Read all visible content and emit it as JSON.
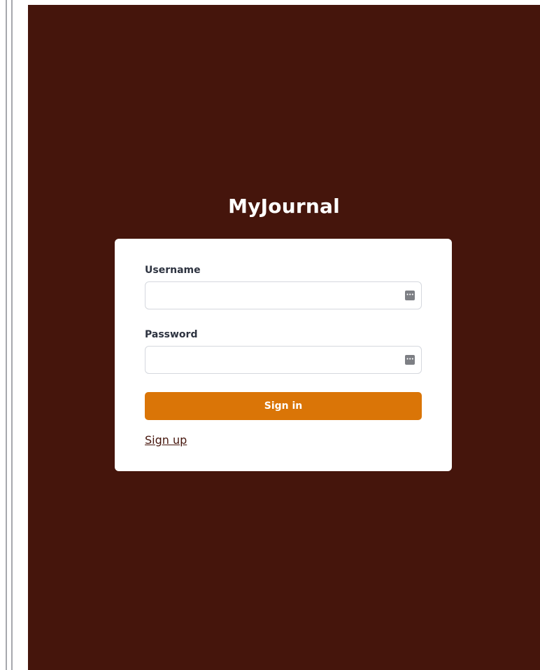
{
  "app": {
    "title": "MyJournal"
  },
  "login_form": {
    "username": {
      "label": "Username",
      "value": "",
      "placeholder": ""
    },
    "password": {
      "label": "Password",
      "value": "",
      "placeholder": ""
    },
    "sign_in_label": "Sign in",
    "sign_up_label": "Sign up"
  },
  "icons": {
    "field_autofill": "password-manager-icon"
  },
  "colors": {
    "page_background": "#45150c",
    "card_background": "#ffffff",
    "primary_button": "#da7507",
    "link": "#45150c"
  }
}
